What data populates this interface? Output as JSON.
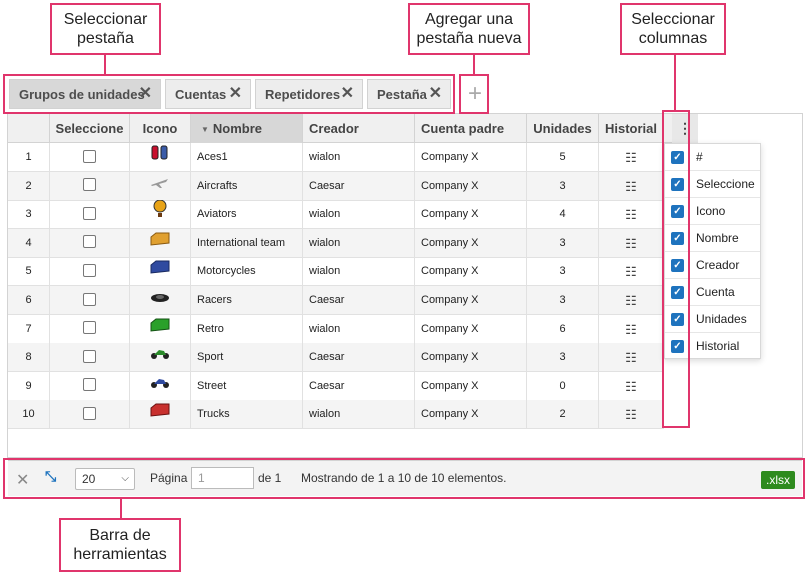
{
  "annotations": {
    "select_tab": "Seleccionar\npestaña",
    "add_tab": "Agregar una\npestaña nueva",
    "select_columns": "Seleccionar\ncolumnas",
    "toolbar": "Barra de\nherramientas"
  },
  "tabs": [
    {
      "label": "Grupos de unidades",
      "active": true
    },
    {
      "label": "Cuentas",
      "active": false
    },
    {
      "label": "Repetidores",
      "active": false
    },
    {
      "label": "Pestaña",
      "active": false
    }
  ],
  "tab_close_glyph": "✕",
  "add_tab_glyph": "+",
  "columns": {
    "select": "Seleccione",
    "icon": "Icono",
    "name": "Nombre",
    "creator": "Creador",
    "account": "Cuenta padre",
    "units": "Unidades",
    "history": "Historial"
  },
  "column_menu_glyph": "⋮",
  "rows": [
    {
      "num": "1",
      "icon": "fuel-tanks-icon",
      "name": "Aces1",
      "creator": "wialon",
      "account": "Company X",
      "units": "5"
    },
    {
      "num": "2",
      "icon": "aircraft-icon",
      "name": "Aircrafts",
      "creator": "Caesar",
      "account": "Company X",
      "units": "3"
    },
    {
      "num": "3",
      "icon": "hot-air-balloon-icon",
      "name": "Aviators",
      "creator": "wialon",
      "account": "Company X",
      "units": "4"
    },
    {
      "num": "4",
      "icon": "yellow-truck-icon",
      "name": "International team",
      "creator": "wialon",
      "account": "Company X",
      "units": "3"
    },
    {
      "num": "5",
      "icon": "blue-truck-icon",
      "name": "Motorcycles",
      "creator": "wialon",
      "account": "Company X",
      "units": "3"
    },
    {
      "num": "6",
      "icon": "race-car-icon",
      "name": "Racers",
      "creator": "Caesar",
      "account": "Company X",
      "units": "3"
    },
    {
      "num": "7",
      "icon": "green-truck-icon",
      "name": "Retro",
      "creator": "wialon",
      "account": "Company X",
      "units": "6"
    },
    {
      "num": "8",
      "icon": "green-motorcycle-icon",
      "name": "Sport",
      "creator": "Caesar",
      "account": "Company X",
      "units": "3"
    },
    {
      "num": "9",
      "icon": "blue-motorcycle-icon",
      "name": "Street",
      "creator": "Caesar",
      "account": "Company X",
      "units": "0"
    },
    {
      "num": "10",
      "icon": "red-truck-icon",
      "name": "Trucks",
      "creator": "wialon",
      "account": "Company X",
      "units": "2"
    }
  ],
  "history_glyph": "☷",
  "column_picker": [
    {
      "label": "#",
      "checked": true
    },
    {
      "label": "Seleccione",
      "checked": true
    },
    {
      "label": "Icono",
      "checked": true
    },
    {
      "label": "Nombre",
      "checked": true
    },
    {
      "label": "Creador",
      "checked": true
    },
    {
      "label": "Cuenta",
      "checked": true
    },
    {
      "label": "Unidades",
      "checked": true
    },
    {
      "label": "Historial",
      "checked": true
    }
  ],
  "checkmark_glyph": "✓",
  "toolbar": {
    "clear_glyph": "✕",
    "fit_glyph": "⤡",
    "page_size": "20",
    "page_size_chevron": "⌵",
    "page_label": "Página",
    "page_placeholder": "1",
    "of_label": "de 1",
    "status": "Mostrando de 1 a 10 de 10 elementos.",
    "export_label": ".xlsx"
  },
  "colors": {
    "callout_border": "#e0356c",
    "checkbox_blue": "#1e73be",
    "export_green": "#2e8b1e"
  }
}
